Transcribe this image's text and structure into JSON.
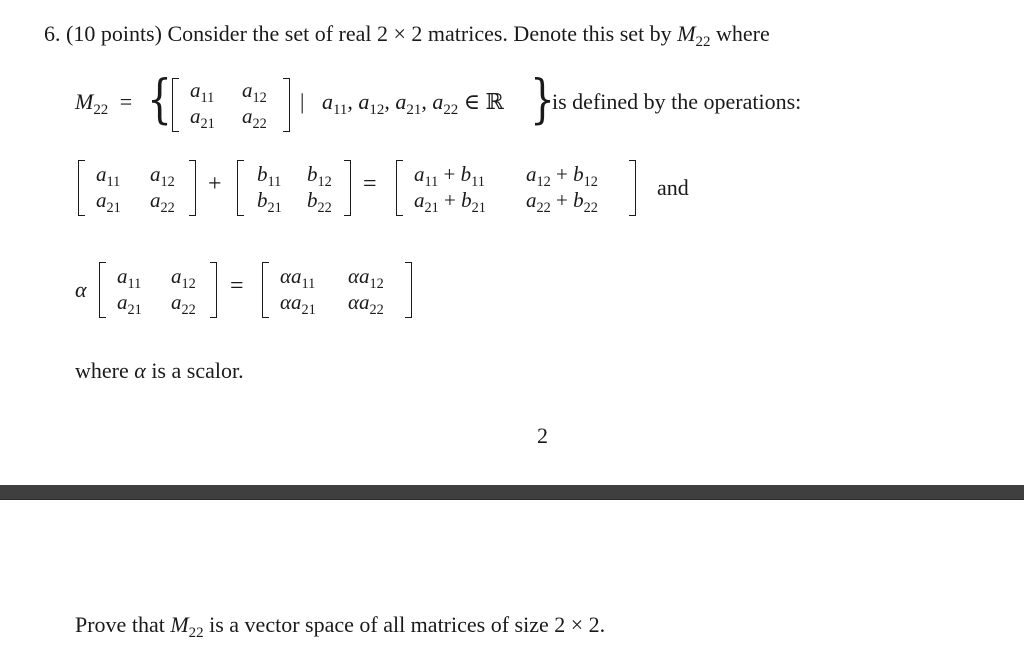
{
  "problem": {
    "number": "6.",
    "points": "(10 points)",
    "intro_text": "Consider the set of real 2 × 2 matrices. Denote this set by",
    "set_name": "M",
    "set_sub": "22",
    "intro_end": "where",
    "definition": {
      "lhs_name": "M",
      "lhs_sub": "22",
      "equals": "=",
      "condition_bar": "|",
      "condition": "a11, a12, a21, a22 ∈ ℝ",
      "condition_parts": [
        "a",
        "11",
        ", ",
        "a",
        "12",
        ", ",
        "a",
        "21",
        ", ",
        "a",
        "22",
        " ∈ ℝ"
      ],
      "trailing_text": "is defined by the operations:"
    },
    "matrix_a": [
      [
        "a",
        "11"
      ],
      [
        "a",
        "12"
      ],
      [
        "a",
        "21"
      ],
      [
        "a",
        "22"
      ]
    ],
    "matrix_b": [
      [
        "b",
        "11"
      ],
      [
        "b",
        "12"
      ],
      [
        "b",
        "21"
      ],
      [
        "b",
        "22"
      ]
    ],
    "addition": {
      "plus": "+",
      "equals": "=",
      "result": [
        {
          "a": "a",
          "as": "11",
          "op": " + ",
          "b": "b",
          "bs": "11"
        },
        {
          "a": "a",
          "as": "12",
          "op": " + ",
          "b": "b",
          "bs": "12"
        },
        {
          "a": "a",
          "as": "21",
          "op": " + ",
          "b": "b",
          "bs": "21"
        },
        {
          "a": "a",
          "as": "22",
          "op": " + ",
          "b": "b",
          "bs": "22"
        }
      ],
      "conjunction": "and"
    },
    "scalar": {
      "alpha": "α",
      "equals": "=",
      "result": [
        {
          "s": "α",
          "a": "a",
          "as": "11"
        },
        {
          "s": "α",
          "a": "a",
          "as": "12"
        },
        {
          "s": "α",
          "a": "a",
          "as": "21"
        },
        {
          "s": "α",
          "a": "a",
          "as": "22"
        }
      ]
    },
    "scalar_note": {
      "pre": "where",
      "alpha": "α",
      "post": "is a scalor."
    },
    "page_number": "2",
    "task": {
      "pre": "Prove that",
      "name": "M",
      "sub": "22",
      "post": "is a vector space of all matrices of size 2 × 2."
    }
  },
  "colors": {
    "text": "#1a1a1a",
    "divider": "#3f3f3f",
    "background": "#ffffff"
  }
}
